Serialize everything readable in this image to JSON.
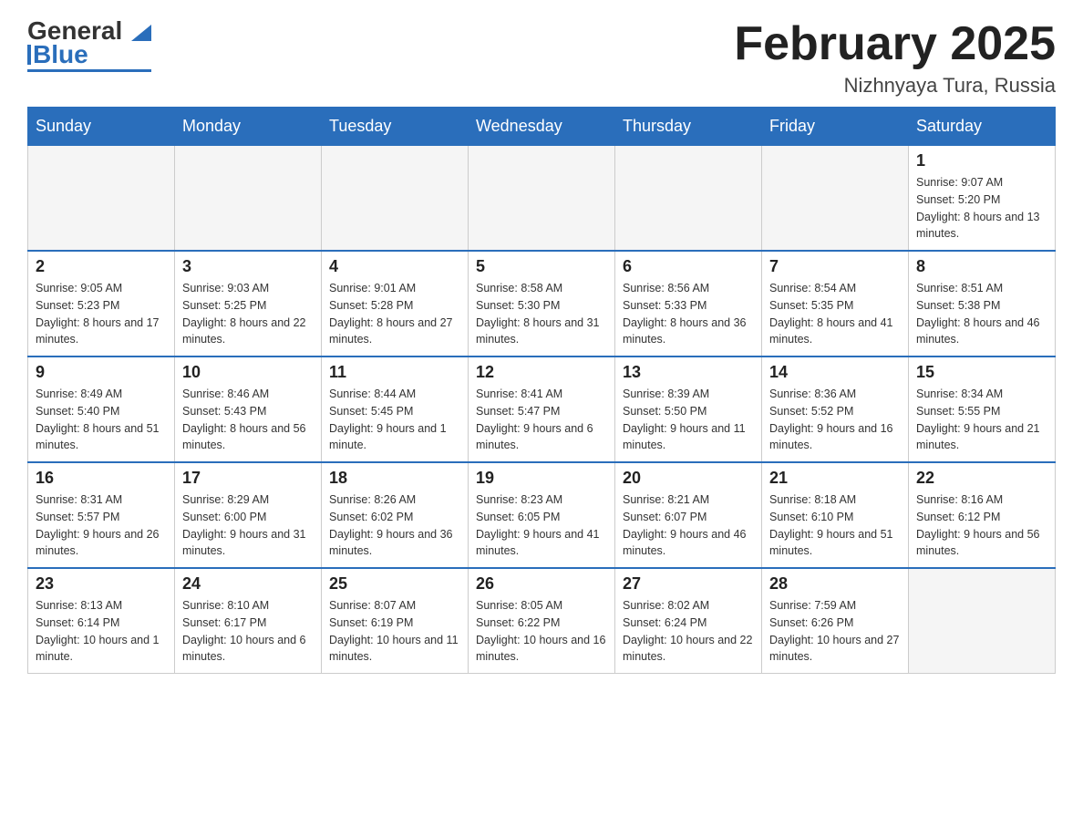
{
  "header": {
    "logo_general": "General",
    "logo_blue": "Blue",
    "month_title": "February 2025",
    "location": "Nizhnyaya Tura, Russia"
  },
  "days_of_week": [
    "Sunday",
    "Monday",
    "Tuesday",
    "Wednesday",
    "Thursday",
    "Friday",
    "Saturday"
  ],
  "weeks": [
    [
      {
        "day": "",
        "info": ""
      },
      {
        "day": "",
        "info": ""
      },
      {
        "day": "",
        "info": ""
      },
      {
        "day": "",
        "info": ""
      },
      {
        "day": "",
        "info": ""
      },
      {
        "day": "",
        "info": ""
      },
      {
        "day": "1",
        "info": "Sunrise: 9:07 AM\nSunset: 5:20 PM\nDaylight: 8 hours and 13 minutes."
      }
    ],
    [
      {
        "day": "2",
        "info": "Sunrise: 9:05 AM\nSunset: 5:23 PM\nDaylight: 8 hours and 17 minutes."
      },
      {
        "day": "3",
        "info": "Sunrise: 9:03 AM\nSunset: 5:25 PM\nDaylight: 8 hours and 22 minutes."
      },
      {
        "day": "4",
        "info": "Sunrise: 9:01 AM\nSunset: 5:28 PM\nDaylight: 8 hours and 27 minutes."
      },
      {
        "day": "5",
        "info": "Sunrise: 8:58 AM\nSunset: 5:30 PM\nDaylight: 8 hours and 31 minutes."
      },
      {
        "day": "6",
        "info": "Sunrise: 8:56 AM\nSunset: 5:33 PM\nDaylight: 8 hours and 36 minutes."
      },
      {
        "day": "7",
        "info": "Sunrise: 8:54 AM\nSunset: 5:35 PM\nDaylight: 8 hours and 41 minutes."
      },
      {
        "day": "8",
        "info": "Sunrise: 8:51 AM\nSunset: 5:38 PM\nDaylight: 8 hours and 46 minutes."
      }
    ],
    [
      {
        "day": "9",
        "info": "Sunrise: 8:49 AM\nSunset: 5:40 PM\nDaylight: 8 hours and 51 minutes."
      },
      {
        "day": "10",
        "info": "Sunrise: 8:46 AM\nSunset: 5:43 PM\nDaylight: 8 hours and 56 minutes."
      },
      {
        "day": "11",
        "info": "Sunrise: 8:44 AM\nSunset: 5:45 PM\nDaylight: 9 hours and 1 minute."
      },
      {
        "day": "12",
        "info": "Sunrise: 8:41 AM\nSunset: 5:47 PM\nDaylight: 9 hours and 6 minutes."
      },
      {
        "day": "13",
        "info": "Sunrise: 8:39 AM\nSunset: 5:50 PM\nDaylight: 9 hours and 11 minutes."
      },
      {
        "day": "14",
        "info": "Sunrise: 8:36 AM\nSunset: 5:52 PM\nDaylight: 9 hours and 16 minutes."
      },
      {
        "day": "15",
        "info": "Sunrise: 8:34 AM\nSunset: 5:55 PM\nDaylight: 9 hours and 21 minutes."
      }
    ],
    [
      {
        "day": "16",
        "info": "Sunrise: 8:31 AM\nSunset: 5:57 PM\nDaylight: 9 hours and 26 minutes."
      },
      {
        "day": "17",
        "info": "Sunrise: 8:29 AM\nSunset: 6:00 PM\nDaylight: 9 hours and 31 minutes."
      },
      {
        "day": "18",
        "info": "Sunrise: 8:26 AM\nSunset: 6:02 PM\nDaylight: 9 hours and 36 minutes."
      },
      {
        "day": "19",
        "info": "Sunrise: 8:23 AM\nSunset: 6:05 PM\nDaylight: 9 hours and 41 minutes."
      },
      {
        "day": "20",
        "info": "Sunrise: 8:21 AM\nSunset: 6:07 PM\nDaylight: 9 hours and 46 minutes."
      },
      {
        "day": "21",
        "info": "Sunrise: 8:18 AM\nSunset: 6:10 PM\nDaylight: 9 hours and 51 minutes."
      },
      {
        "day": "22",
        "info": "Sunrise: 8:16 AM\nSunset: 6:12 PM\nDaylight: 9 hours and 56 minutes."
      }
    ],
    [
      {
        "day": "23",
        "info": "Sunrise: 8:13 AM\nSunset: 6:14 PM\nDaylight: 10 hours and 1 minute."
      },
      {
        "day": "24",
        "info": "Sunrise: 8:10 AM\nSunset: 6:17 PM\nDaylight: 10 hours and 6 minutes."
      },
      {
        "day": "25",
        "info": "Sunrise: 8:07 AM\nSunset: 6:19 PM\nDaylight: 10 hours and 11 minutes."
      },
      {
        "day": "26",
        "info": "Sunrise: 8:05 AM\nSunset: 6:22 PM\nDaylight: 10 hours and 16 minutes."
      },
      {
        "day": "27",
        "info": "Sunrise: 8:02 AM\nSunset: 6:24 PM\nDaylight: 10 hours and 22 minutes."
      },
      {
        "day": "28",
        "info": "Sunrise: 7:59 AM\nSunset: 6:26 PM\nDaylight: 10 hours and 27 minutes."
      },
      {
        "day": "",
        "info": ""
      }
    ]
  ]
}
